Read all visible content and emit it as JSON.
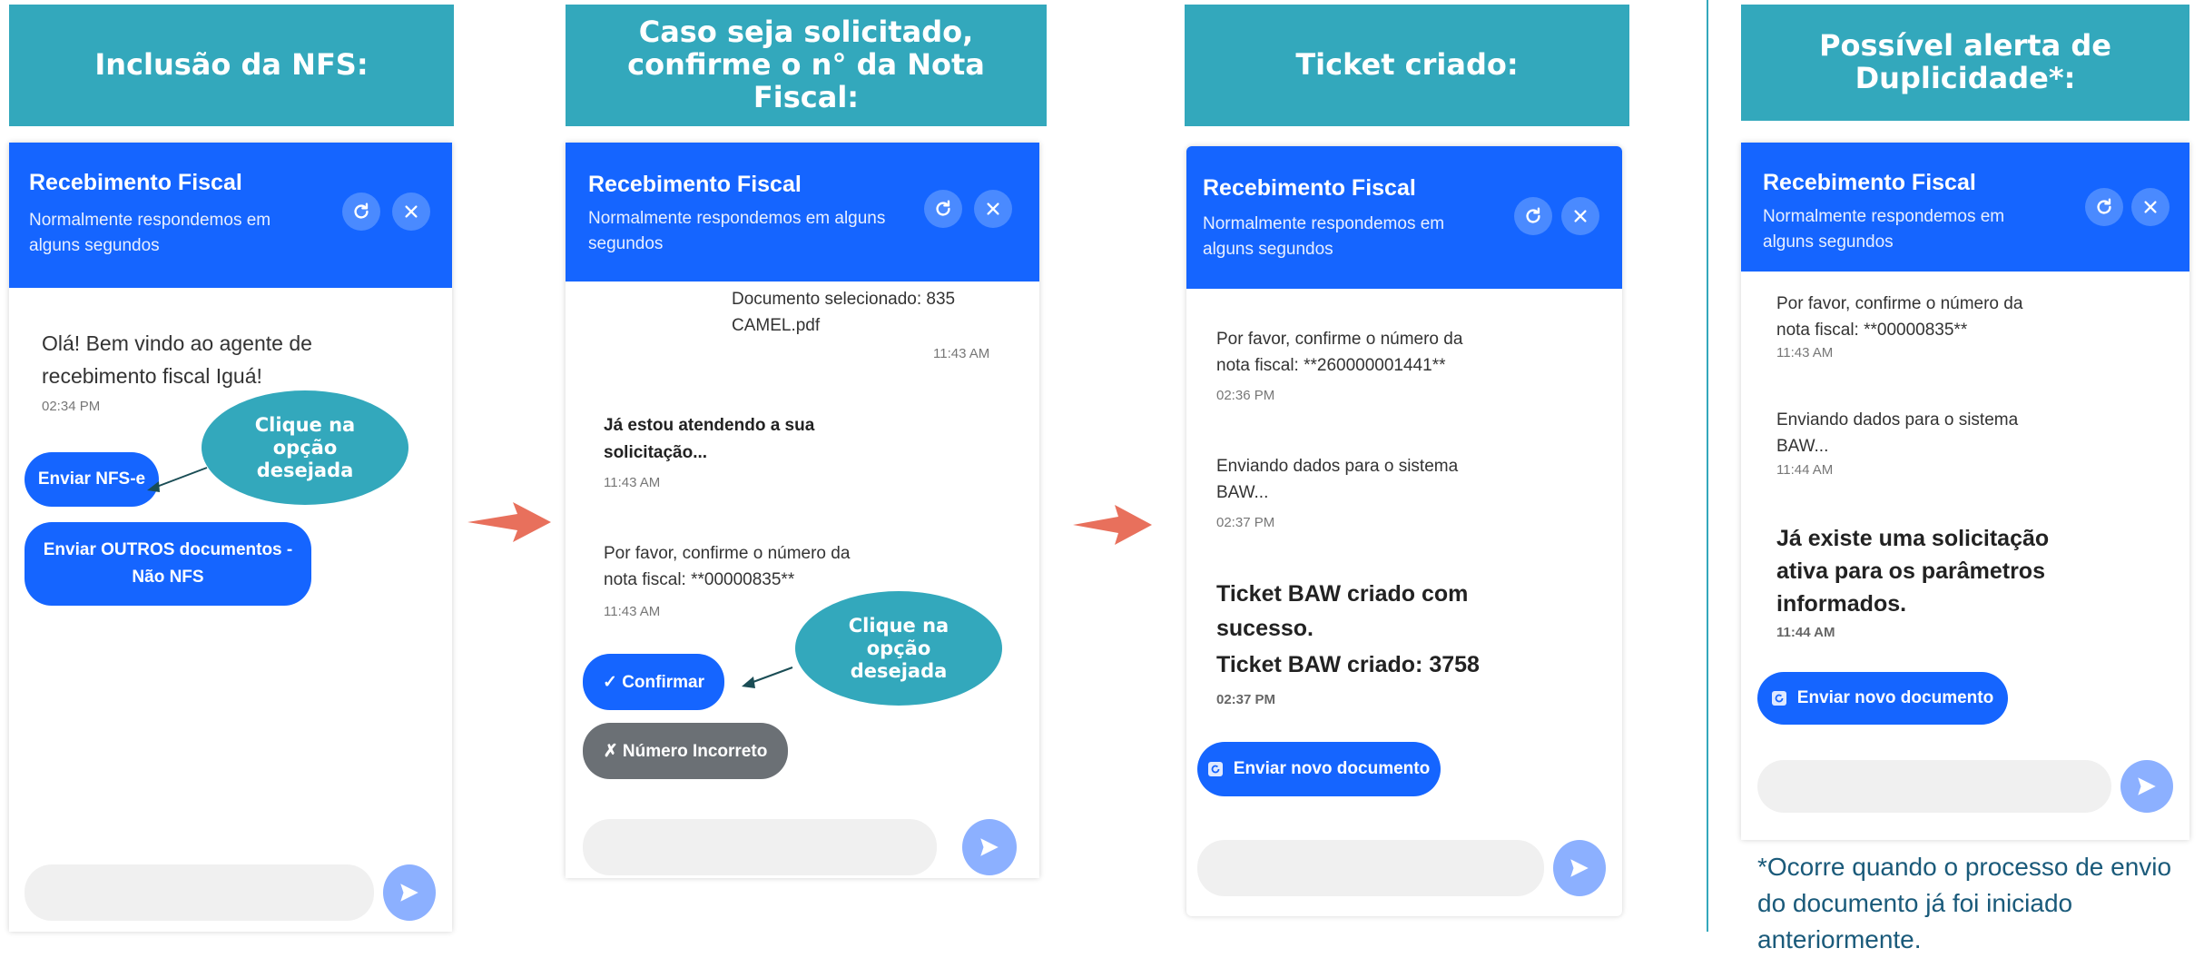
{
  "colors": {
    "header_teal": "#33a8bc",
    "chat_blue": "#1565ff",
    "arrow": "#e8705c",
    "secondary_button": "#6b7075"
  },
  "chat": {
    "title": "Recebimento Fiscal",
    "subtitle": "Normalmente respondemos em alguns segundos",
    "icons": [
      "refresh-icon",
      "close-icon",
      "send-icon"
    ]
  },
  "callout": {
    "text": "Clique na opção desejada"
  },
  "step1": {
    "header": "Inclusão da NFS:",
    "greeting": "Olá! Bem vindo ao agente de recebimento fiscal Iguá!",
    "greeting_time": "02:34 PM",
    "btn_nfse": "Enviar NFS-e",
    "btn_outros": "Enviar OUTROS documentos - Não NFS"
  },
  "step2": {
    "header": "Caso seja solicitado, confirme o n° da Nota Fiscal:",
    "doc_selected": "Documento selecionado: 835 CAMEL.pdf",
    "doc_time": "11:43 AM",
    "attending": "Já estou atendendo a sua solicitação...",
    "attending_time": "11:43 AM",
    "confirm_msg": "Por favor, confirme o número da nota fiscal: **00000835**",
    "confirm_time": "11:43 AM",
    "btn_confirm": "✓ Confirmar",
    "btn_incorrect": "✗ Número Incorreto"
  },
  "step3": {
    "header": "Ticket criado:",
    "confirm_msg": "Por favor, confirme o número da nota fiscal: **260000001441**",
    "confirm_time": "02:36 PM",
    "sending_msg": "Enviando dados para o sistema BAW...",
    "sending_time": "02:37 PM",
    "ticket_line1": "Ticket BAW criado com sucesso.",
    "ticket_line2": "Ticket BAW criado: 3758",
    "ticket_time": "02:37 PM",
    "btn_new": "Enviar novo documento"
  },
  "step4": {
    "header": "Possível alerta de Duplicidade*:",
    "confirm_msg": "Por favor, confirme o número da nota fiscal: **00000835**",
    "confirm_time": "11:43 AM",
    "sending_msg": "Enviando dados para o sistema BAW...",
    "sending_time": "11:44 AM",
    "alert_msg": "Já existe uma solicitação ativa para os parâmetros informados.",
    "alert_time": "11:44 AM",
    "btn_new": "Enviar novo documento",
    "footnote": "*Ocorre quando o processo de envio do documento já foi iniciado anteriormente."
  }
}
